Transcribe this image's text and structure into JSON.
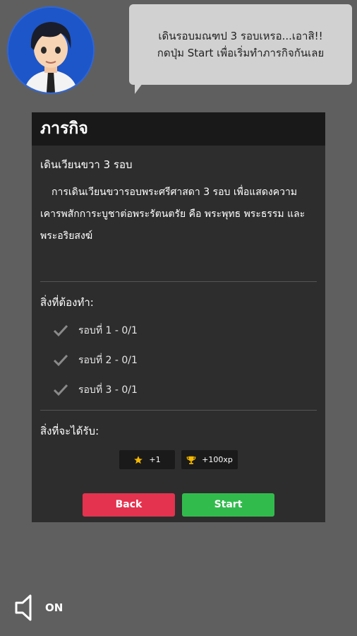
{
  "speech": {
    "line1": "เดินรอบมณฑป 3 รอบเหรอ...เอาสิ!!",
    "line2": "กดปุ่ม Start เพื่อเริ่มทำภารกิจกันเลย"
  },
  "panel": {
    "title": "ภารกิจ",
    "mission_name": "เดินเวียนขวา 3 รอบ",
    "mission_description": "การเดินเวียนขวารอบพระศรีศาสดา 3 รอบ เพื่อแสดงความเคารพสักการะบูชาต่อพระรัตนตรัย คือ พระพุทธ พระธรรม และพระอริยสงฆ์",
    "todo_label": "สิ่งที่ต้องทำ:",
    "tasks": [
      {
        "label": "รอบที่ 1 - 0/1"
      },
      {
        "label": "รอบที่ 2 - 0/1"
      },
      {
        "label": "รอบที่ 3 - 0/1"
      }
    ],
    "reward_label": "สิ่งที่จะได้รับ:",
    "rewards": [
      {
        "icon": "star-icon",
        "value": "+1",
        "color": "#f5b800"
      },
      {
        "icon": "trophy-icon",
        "value": "+100xp",
        "color": "#f5b800"
      }
    ],
    "back_label": "Back",
    "start_label": "Start"
  },
  "sound": {
    "icon": "speaker-icon",
    "label": "ON"
  },
  "colors": {
    "background": "#5f5f5f",
    "panel": "#2d2d2d",
    "header": "#191919",
    "back": "#e3334e",
    "start": "#32bb4d",
    "bubble": "#d1d1d1",
    "avatar_bg": "#1d56c9"
  }
}
